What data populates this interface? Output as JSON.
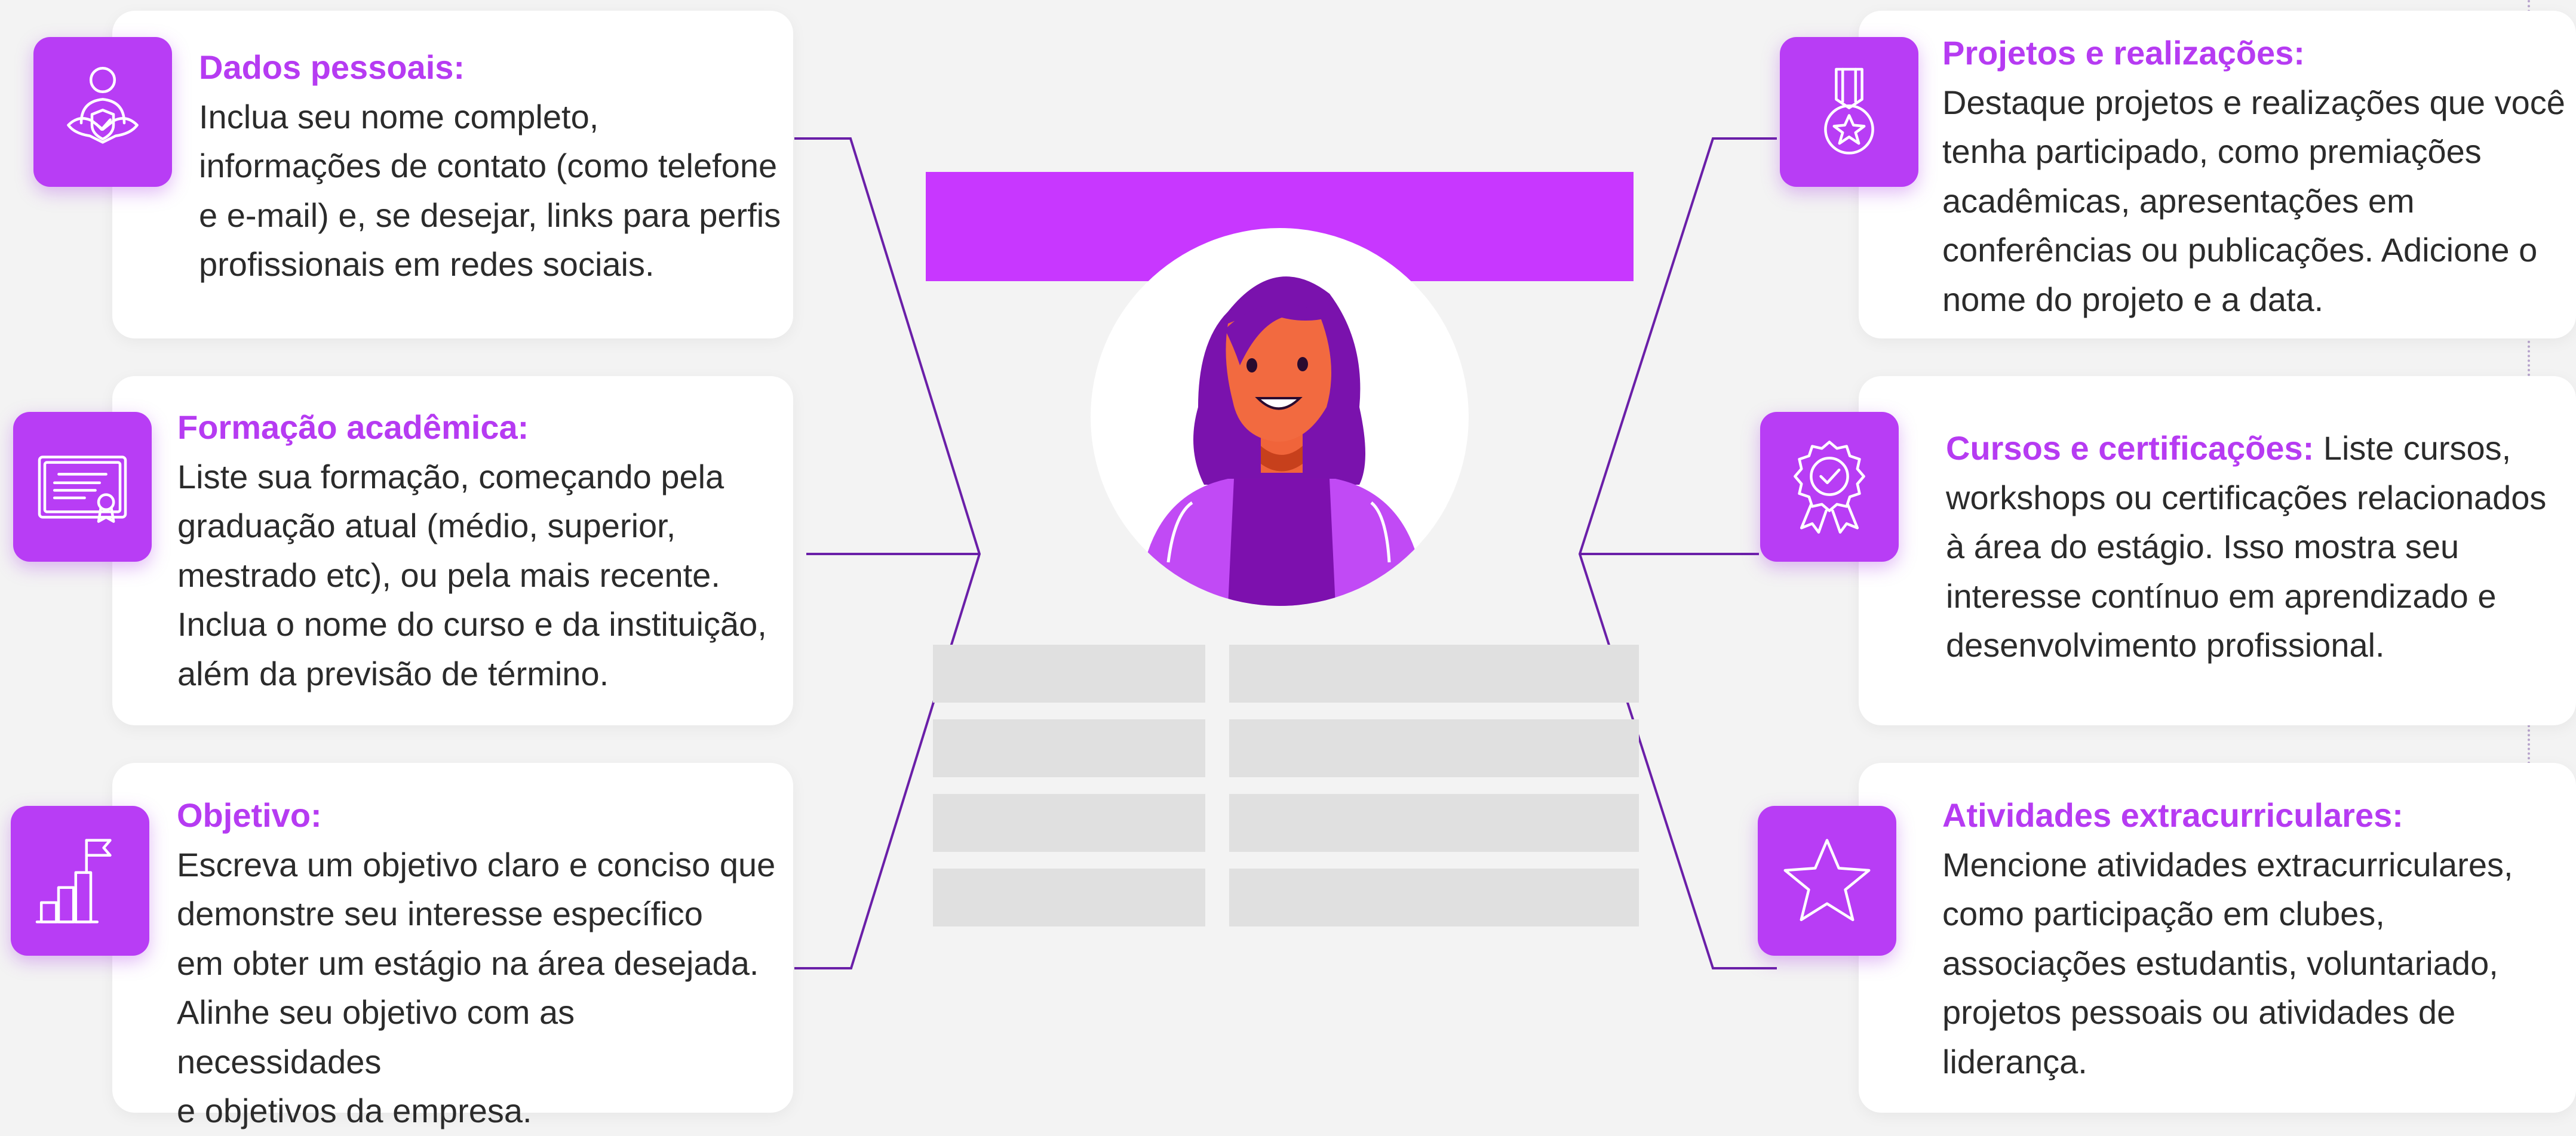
{
  "colors": {
    "accent": "#b63bf2",
    "icon_bg": "#b83df5",
    "connector": "#6a1fa8",
    "bar": "#c837ff",
    "placeholder": "#e0e0e0"
  },
  "left_cards": [
    {
      "icon": "person-shield-icon",
      "title": "Dados pessoais:",
      "lines": [
        "Inclua seu nome completo,",
        "informações de contato (como telefone",
        "e e-mail) e, se desejar, links para perfis",
        "profissionais em redes sociais."
      ]
    },
    {
      "icon": "diploma-certificate-icon",
      "title": "Formação acadêmica:",
      "lines": [
        "Liste sua formação, começando pela",
        "graduação atual (médio, superior,",
        "mestrado etc), ou pela mais recente.",
        "Inclua o nome do curso e da instituição,",
        "além da previsão de término."
      ]
    },
    {
      "icon": "goal-chart-flag-icon",
      "title": "Objetivo:",
      "lines": [
        "Escreva um objetivo claro e conciso que",
        "demonstre seu interesse específico",
        "em obter um estágio na área desejada.",
        "Alinhe seu objetivo com as necessidades",
        "e objetivos da empresa."
      ]
    }
  ],
  "right_cards": [
    {
      "icon": "medal-star-icon",
      "title": "Projetos e realizações:",
      "lines": [
        "Destaque projetos e realizações que você",
        "tenha participado, como premiações",
        "acadêmicas, apresentações em",
        "conferências ou publicações. Adicione o",
        "nome do projeto e a data."
      ]
    },
    {
      "icon": "badge-ribbon-check-icon",
      "title": "Cursos e certificações:",
      "first_line_rest": " Liste cursos,",
      "lines": [
        "workshops ou certificações relacionados",
        "à área do estágio. Isso mostra seu",
        "interesse contínuo em aprendizado e",
        "desenvolvimento profissional."
      ]
    },
    {
      "icon": "star-icon",
      "title": "Atividades extracurriculares:",
      "lines": [
        "Mencione atividades extracurriculares,",
        "como participação em clubes,",
        "associações estudantis, voluntariado,",
        "projetos pessoais ou atividades de",
        "liderança."
      ]
    }
  ],
  "center": {
    "avatar": "woman-avatar-illustration"
  }
}
